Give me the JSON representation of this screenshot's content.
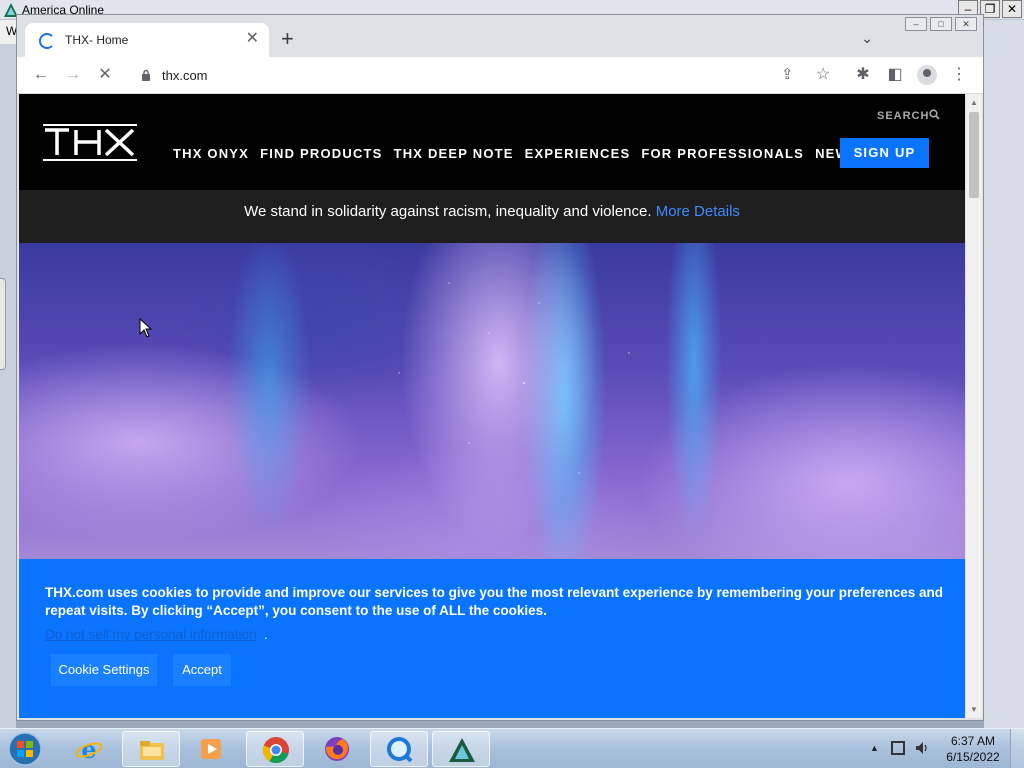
{
  "aol": {
    "title": "America  Online",
    "menu_letter": "W",
    "controls": [
      "–",
      "❐",
      "✕"
    ]
  },
  "chrome": {
    "tab": {
      "title": "THX- Home",
      "close": "✕"
    },
    "new_tab": "+",
    "tab_search": "⌄",
    "window_controls": [
      "–",
      "□",
      "✕"
    ],
    "toolbar": {
      "back": "←",
      "forward": "→",
      "reload": "✕",
      "url": "thx.com",
      "share": "⇪",
      "bookmark": "☆",
      "extensions": "✱",
      "sidepanel": "◧",
      "menu": "⋮"
    }
  },
  "site": {
    "search_label": "SEARCH",
    "nav": [
      "THX ONYX",
      "FIND PRODUCTS",
      "THX DEEP NOTE",
      "EXPERIENCES",
      "FOR PROFESSIONALS",
      "NEWS"
    ],
    "signup": "SIGN UP",
    "banner_text": "We stand in solidarity against racism, inequality and violence. ",
    "banner_link": "More Details",
    "cookie": {
      "text": "THX.com uses cookies to provide and improve our services to give you the most relevant experience by remembering your preferences and repeat visits. By clicking “Accept”, you consent to the use of ALL the cookies.",
      "link": "Do not sell my personal information",
      "link_suffix": ".",
      "settings_btn": "Cookie Settings",
      "accept_btn": "Accept"
    },
    "colors": {
      "brand_blue": "#0a74ff",
      "banner_bg": "#1e1e1e",
      "link_blue": "#3d8bff"
    }
  },
  "taskbar": {
    "time": "6:37 AM",
    "date": "6/15/2022",
    "tray_arrow": "▲",
    "apps": [
      "internet-explorer",
      "file-explorer",
      "media-player",
      "chrome",
      "firefox",
      "quicktime",
      "aol"
    ]
  }
}
